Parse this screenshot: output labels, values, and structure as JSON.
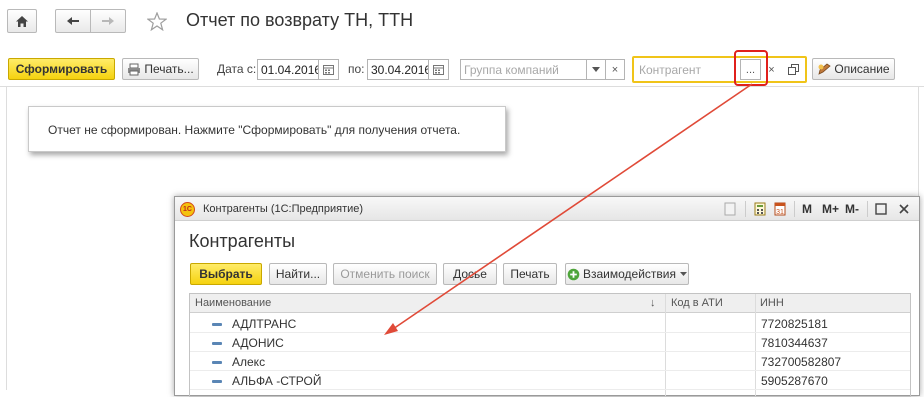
{
  "header": {
    "title": "Отчет по возврату ТН, ТТН"
  },
  "toolbar": {
    "generate_label": "Сформировать",
    "print_label": "Печать...",
    "date_from_label": "Дата с:",
    "date_from_value": "01.04.2016",
    "date_to_label": "по:",
    "date_to_value": "30.04.2016",
    "company_group_placeholder": "Группа компаний",
    "counterparty_placeholder": "Контрагент",
    "select_button_label": "...",
    "clear_symbol": "×",
    "description_label": "Описание"
  },
  "message": {
    "text": "Отчет не сформирован. Нажмите \"Сформировать\" для получения отчета."
  },
  "popup": {
    "title": "Контрагенты  (1С:Предприятие)",
    "heading": "Контрагенты",
    "logo_text": "1С",
    "title_buttons": [
      "M",
      "M+",
      "M-"
    ],
    "buttons": {
      "select": "Выбрать",
      "find": "Найти...",
      "cancel_search": "Отменить поиск",
      "dossier": "Досье",
      "print": "Печать",
      "interactions": "Взаимодействия"
    },
    "columns": {
      "name": "Наименование",
      "ati_code": "Код в АТИ",
      "inn": "ИНН",
      "sort_arrow": "↓"
    },
    "rows": [
      {
        "name": "АДЛТРАНС",
        "ati": "",
        "inn": "7720825181"
      },
      {
        "name": "АДОНИС",
        "ati": "",
        "inn": "7810344637"
      },
      {
        "name": "Алекс",
        "ati": "",
        "inn": "732700582807"
      },
      {
        "name": "АЛЬФА -СТРОЙ",
        "ati": "",
        "inn": "5905287670"
      }
    ]
  },
  "colors": {
    "primary_button": "#f5d20f",
    "highlight_border": "#e0201c",
    "annotation_arrow": "#e04a38",
    "counterparty_border": "#f0c419",
    "row_marker": "#5a86b5"
  },
  "icons": {
    "home": "home-icon",
    "back": "arrow-left-icon",
    "forward": "arrow-right-icon",
    "favorite": "star-icon",
    "printer": "printer-icon",
    "calendar": "calendar-icon",
    "dropdown": "chevron-down-icon",
    "open": "open-form-icon",
    "description": "description-icon",
    "interactions": "plus-circle-icon"
  }
}
